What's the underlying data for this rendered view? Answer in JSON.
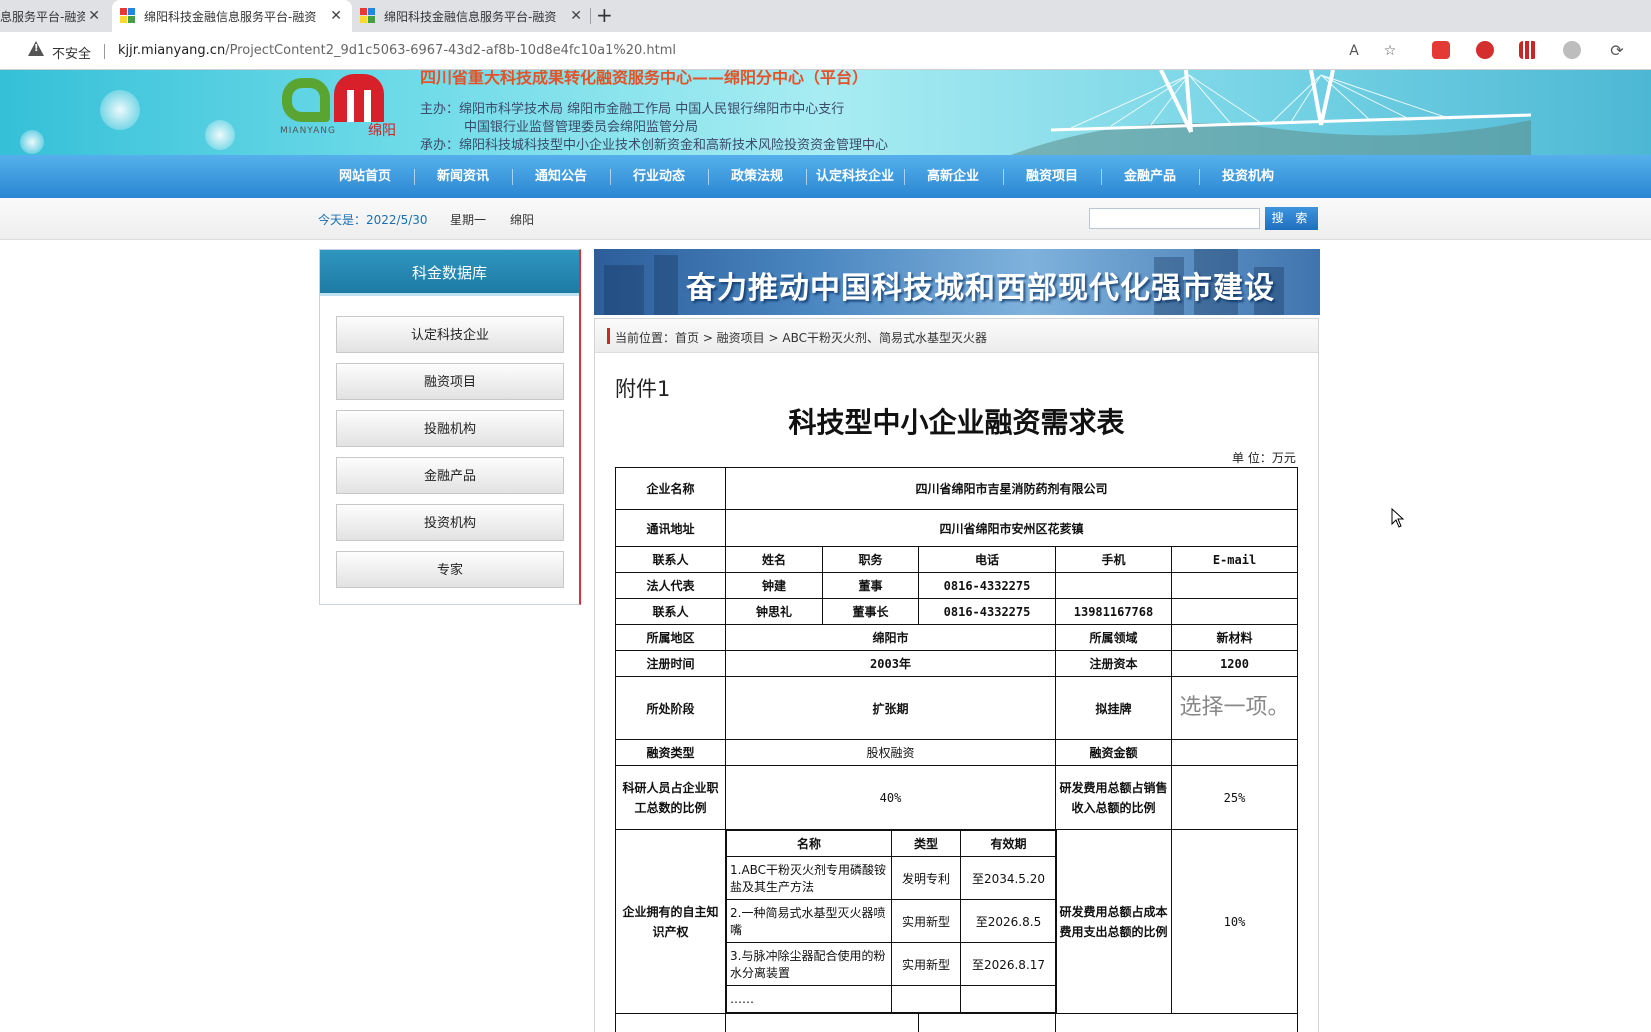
{
  "browser": {
    "tabs": [
      {
        "title": "息服务平台-融资",
        "active": false
      },
      {
        "title": "绵阳科技金融信息服务平台-融资",
        "active": true
      },
      {
        "title": "绵阳科技金融信息服务平台-融资",
        "active": false
      }
    ],
    "insecure_label": "不安全",
    "url_host": "kjjr.mianyang.cn",
    "url_path": "/ProjectContent2_9d1c5063-6967-43d2-af8b-10d8e4fc10a1%20.html"
  },
  "header": {
    "logo_sub": "MIANYANG",
    "logo_cn": "绵阳",
    "title": "四川省重大科技成果转化融资服务中心——绵阳分中心（平台）",
    "sponsor_line1": "主办：绵阳市科学技术局  绵阳市金融工作局  中国人民银行绵阳市中心支行",
    "sponsor_line2": "中国银行业监督管理委员会绵阳监管分局",
    "sponsor_line3": "承办：绵阳科技城科技型中小企业技术创新资金和高新技术风险投资资金管理中心"
  },
  "nav": [
    "网站首页",
    "新闻资讯",
    "通知公告",
    "行业动态",
    "政策法规",
    "认定科技企业",
    "高新企业",
    "融资项目",
    "金融产品",
    "投资机构"
  ],
  "subbar": {
    "today_label": "今天是：",
    "date": "2022/5/30",
    "weekday": "星期一",
    "city": "绵阳",
    "search_button": "搜 索"
  },
  "sidebar": {
    "title": "科金数据库",
    "items": [
      "认定科技企业",
      "融资项目",
      "投融机构",
      "金融产品",
      "投资机构",
      "专家"
    ]
  },
  "main": {
    "slogan": "奋力推动中国科技城和西部现代化强市建设",
    "breadcrumb": "当前位置：首页 >  融资项目 > ABC干粉灭火剂、简易式水基型灭火器",
    "attachment": "附件1",
    "doc_title": "科技型中小企业融资需求表",
    "unit": "单 位：万元"
  },
  "table": {
    "company_label": "企业名称",
    "company": "四川省绵阳市吉星消防药剂有限公司",
    "address_label": "通讯地址",
    "address": "四川省绵阳市安州区花荄镇",
    "contact_header": [
      "联系人",
      "姓名",
      "职务",
      "电话",
      "手机",
      "E-mail"
    ],
    "legal_rep": [
      "法人代表",
      "钟建",
      "董事",
      "0816-4332275",
      "",
      ""
    ],
    "contact": [
      "联系人",
      "钟思礼",
      "董事长",
      "0816-4332275",
      "13981167768",
      ""
    ],
    "region_label": "所属地区",
    "region": "绵阳市",
    "field_label": "所属领域",
    "field": "新材料",
    "reg_time_label": "注册时间",
    "reg_time": "2003年",
    "reg_capital_label": "注册资本",
    "reg_capital": "1200",
    "stage_label": "所处阶段",
    "stage": "扩张期",
    "listing_label": "拟挂牌",
    "listing": "选择一项。",
    "fin_type_label": "融资类型",
    "fin_type": "股权融资",
    "fin_amount_label": "融资金额",
    "fin_amount": "",
    "rd_staff_label": "科研人员占企业职工总数的比例",
    "rd_staff": "40%",
    "rd_revenue_label": "研发费用总额占销售收入总额的比例",
    "rd_revenue": "25%",
    "ip_label": "企业拥有的自主知识产权",
    "ip_header": [
      "名称",
      "类型",
      "有效期"
    ],
    "ip_rows": [
      [
        "1.ABC干粉灭火剂专用磷酸铵盐及其生产方法",
        "发明专利",
        "至2034.5.20"
      ],
      [
        "2.一种简易式水基型灭火器喷嘴",
        "实用新型",
        "至2026.8.5"
      ],
      [
        "3.与脉冲除尘器配合使用的粉水分离装置",
        "实用新型",
        "至2026.8.17"
      ],
      [
        "……",
        "",
        ""
      ]
    ],
    "rd_cost_label": "研发费用总额占成本费用支出总额的比例",
    "rd_cost": "10%"
  }
}
